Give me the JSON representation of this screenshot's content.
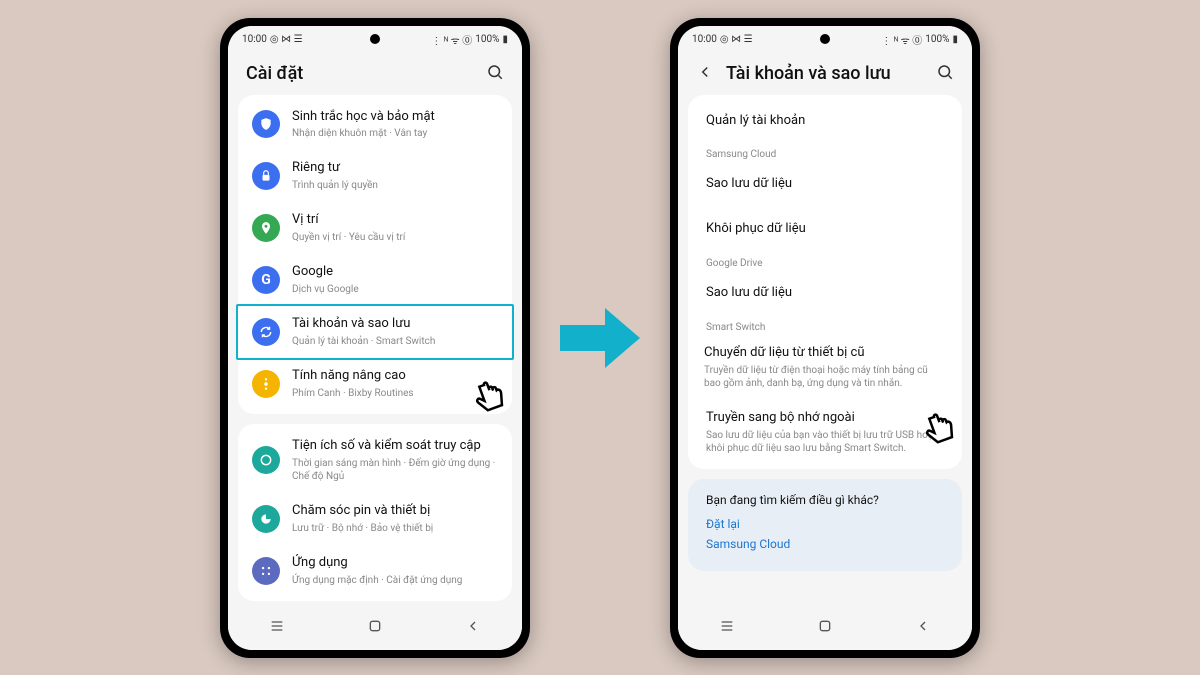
{
  "status": {
    "time": "10:00",
    "battery": "100%",
    "left_icons": "◎ ⋈ ☰",
    "right_icons": "⋮ ᴺ ᯤ ⓪"
  },
  "phone1": {
    "header_title": "Cài đặt",
    "items": {
      "security": {
        "title": "Sinh trắc học và bảo mật",
        "sub": "Nhận diện khuôn mặt · Vân tay"
      },
      "privacy": {
        "title": "Riêng tư",
        "sub": "Trình quản lý quyền"
      },
      "location": {
        "title": "Vị trí",
        "sub": "Quyền vị trí · Yêu cầu vị trí"
      },
      "google": {
        "title": "Google",
        "sub": "Dịch vụ Google"
      },
      "accounts": {
        "title": "Tài khoản và sao lưu",
        "sub": "Quản lý tài khoản · Smart Switch"
      },
      "advanced": {
        "title": "Tính năng nâng cao",
        "sub": "Phím Canh · Bixby Routines"
      },
      "wellbeing": {
        "title": "Tiện ích số và kiểm soát truy cập",
        "sub": "Thời gian sáng màn hình · Đếm giờ ứng dụng · Chế độ Ngủ"
      },
      "battery": {
        "title": "Chăm sóc pin và thiết bị",
        "sub": "Lưu trữ · Bộ nhớ · Bảo vệ thiết bị"
      },
      "apps": {
        "title": "Ứng dụng",
        "sub": "Ứng dụng mặc định · Cài đặt ứng dụng"
      }
    }
  },
  "phone2": {
    "header_title": "Tài khoản và sao lưu",
    "manage_accounts": "Quản lý tài khoản",
    "section_cloud": "Samsung Cloud",
    "backup_data": "Sao lưu dữ liệu",
    "restore_data": "Khôi phục dữ liệu",
    "section_drive": "Google Drive",
    "drive_backup": "Sao lưu dữ liệu",
    "section_switch": "Smart Switch",
    "transfer": {
      "title": "Chuyển dữ liệu từ thiết bị cũ",
      "sub": "Truyền dữ liệu từ điện thoại hoặc máy tính bảng cũ bao gồm ảnh, danh bạ, ứng dụng và tin nhắn."
    },
    "external": {
      "title": "Truyền sang bộ nhớ ngoài",
      "sub": "Sao lưu dữ liệu của bạn vào thiết bị lưu trữ USB hoặc khôi phục dữ liệu sao lưu bằng Smart Switch."
    },
    "info_title": "Bạn đang tìm kiếm điều gì khác?",
    "info_link1": "Đặt lại",
    "info_link2": "Samsung Cloud"
  }
}
